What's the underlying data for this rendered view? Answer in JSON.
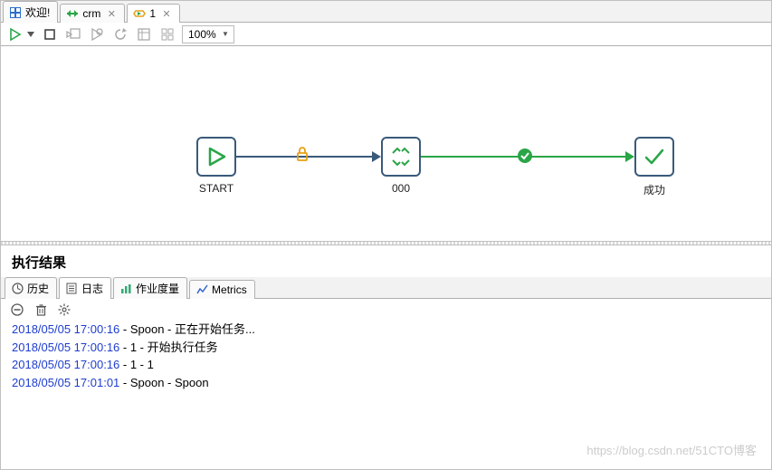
{
  "tabs": [
    {
      "label": "欢迎!"
    },
    {
      "label": "crm"
    },
    {
      "label": "1",
      "active": true
    }
  ],
  "toolbar": {
    "zoom": "100%"
  },
  "nodes": {
    "start": {
      "label": "START"
    },
    "middle": {
      "label": "000"
    },
    "end": {
      "label": "成功"
    }
  },
  "results_title": "执行结果",
  "bottom_tabs": [
    {
      "label": "历史"
    },
    {
      "label": "日志",
      "active": true
    },
    {
      "label": "作业度量"
    },
    {
      "label": "Metrics"
    }
  ],
  "log_lines": [
    {
      "ts": "2018/05/05 17:00:16",
      "msg": " - Spoon - 正在开始任务..."
    },
    {
      "ts": "2018/05/05 17:00:16",
      "msg": " - 1 - 开始执行任务"
    },
    {
      "ts": "2018/05/05 17:00:16",
      "msg": " - 1 - 1"
    },
    {
      "ts": "2018/05/05 17:01:01",
      "msg": " - Spoon - Spoon"
    }
  ],
  "watermark": "https://blog.csdn.net/51CTO博客"
}
